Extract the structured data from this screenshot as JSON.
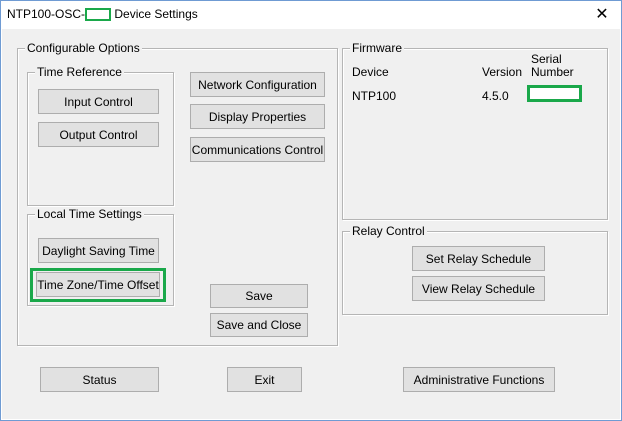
{
  "window": {
    "title_prefix": "NTP100-OSC-",
    "title_suffix": " Device Settings",
    "close_glyph": "✕"
  },
  "configurable_options": {
    "legend": "Configurable Options",
    "time_reference": {
      "legend": "Time Reference",
      "input_control": "Input Control",
      "output_control": "Output Control"
    },
    "network_configuration": "Network Configuration",
    "display_properties": "Display Properties",
    "communications_control": "Communications Control",
    "local_time_settings": {
      "legend": "Local Time Settings",
      "daylight_saving_time": "Daylight Saving Time",
      "time_zone_offset": "Time Zone/Time Offset"
    },
    "save": "Save",
    "save_and_close": "Save and Close"
  },
  "firmware": {
    "legend": "Firmware",
    "columns": {
      "device": "Device",
      "version": "Version",
      "serial_line1": "Serial",
      "serial_line2": "Number"
    },
    "row": {
      "device": "NTP100",
      "version": "4.5.0"
    }
  },
  "relay_control": {
    "legend": "Relay Control",
    "set_relay_schedule": "Set Relay Schedule",
    "view_relay_schedule": "View Relay Schedule"
  },
  "bottom_bar": {
    "status": "Status",
    "exit": "Exit",
    "administrative_functions": "Administrative Functions"
  },
  "colors": {
    "highlight": "#1aa84a",
    "window_border": "#6f9bd3",
    "client_bg": "#f0f0f0"
  }
}
